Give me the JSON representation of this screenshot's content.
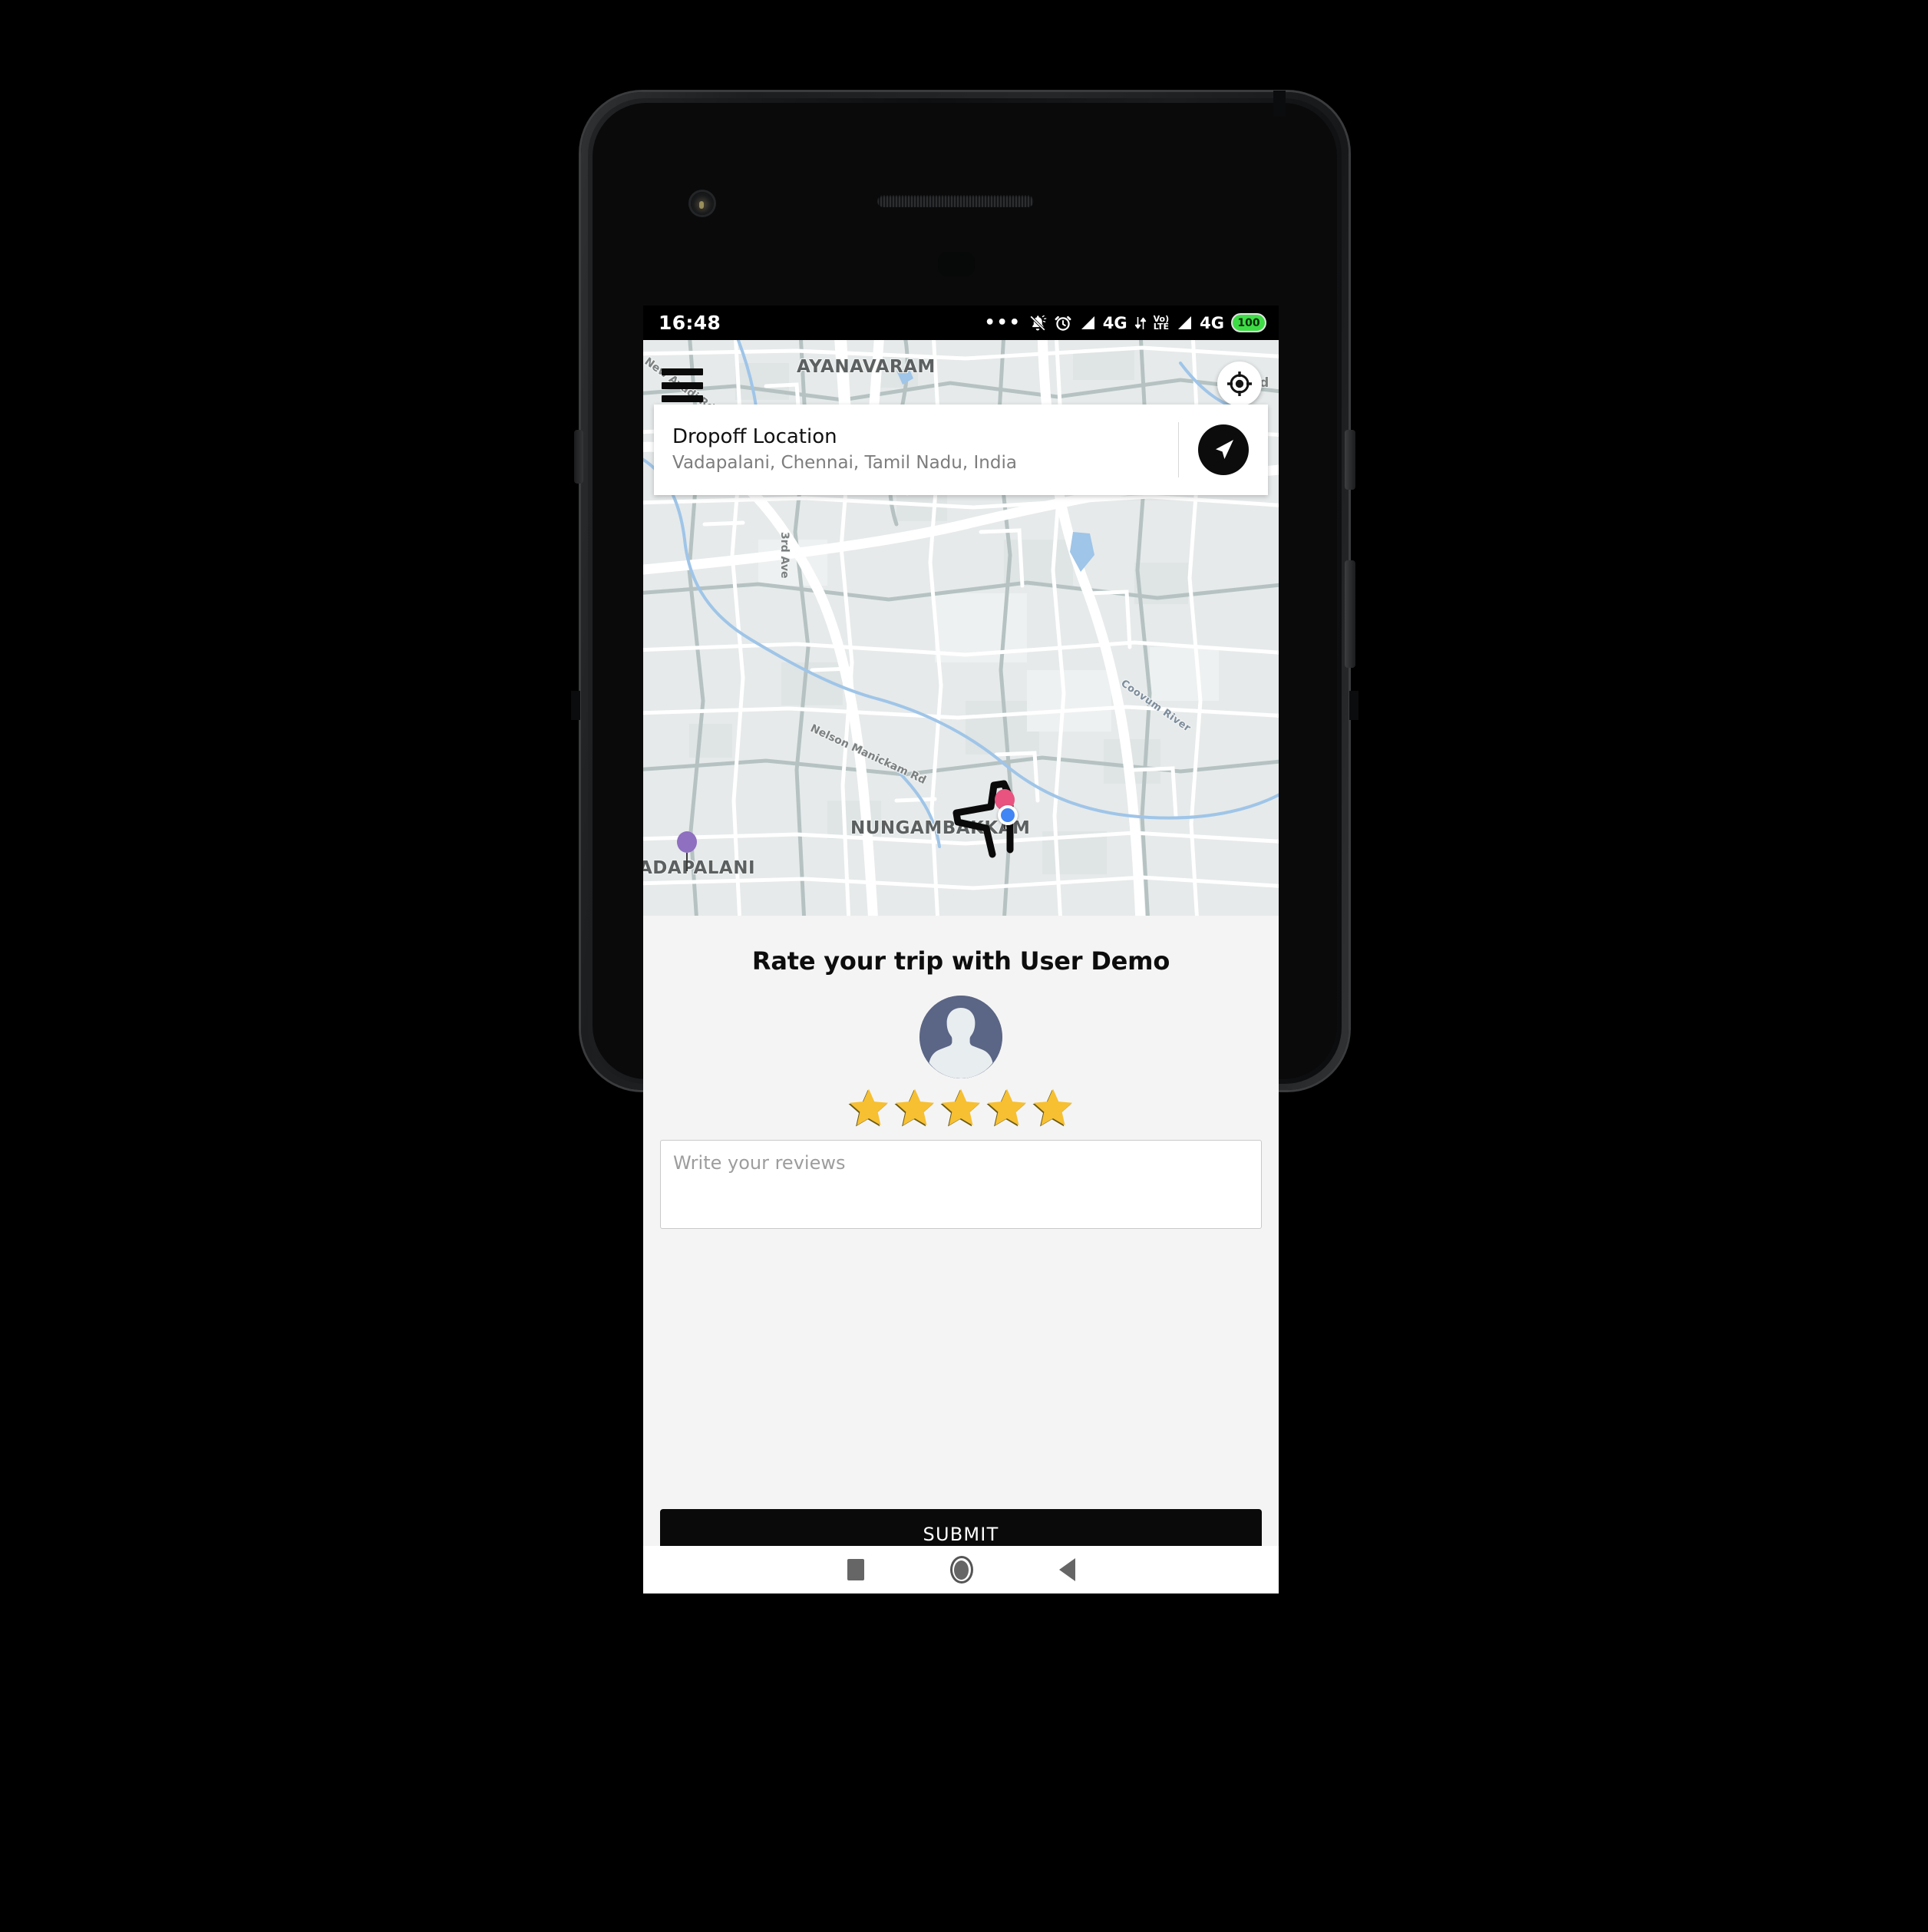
{
  "status_bar": {
    "time": "16:48",
    "icons": [
      "ellipsis-icon",
      "bell-muted-icon",
      "alarm-clock-icon",
      "signal-bars-icon",
      "data-arrows-icon",
      "signal-bars-icon"
    ],
    "network_label_1": "4G",
    "volte_top": "Vo)",
    "volte_bottom": "LTE",
    "network_label_2": "4G",
    "battery_level": "100"
  },
  "map": {
    "menu_icon": "hamburger-menu-icon",
    "locate_icon": "my-location-crosshair-icon",
    "labels": {
      "ayanavaram": "AYANAVARAM",
      "nungambakkam": "NUNGAMBAKKAM",
      "vadapalani": "ADAPALANI",
      "new_avadi_rd": "New Avadi Rd",
      "third_ave": "3rd Ave",
      "nelson_manickam_rd": "Nelson Manickam Rd",
      "coovum_river": "Coovum River",
      "rd_fragment": "Rd"
    },
    "markers": {
      "dropoff_pin_color": "#8e6fc0",
      "pickup_pin_color": "#e8547f",
      "current_location_color": "#4285f4",
      "route_color": "#0a0a0a"
    }
  },
  "dropoff_card": {
    "title": "Dropoff Location",
    "address": "Vadapalani, Chennai, Tamil Nadu, India",
    "nav_icon": "navigation-arrow-icon"
  },
  "rating": {
    "title": "Rate your trip with User Demo",
    "avatar_icon": "default-user-avatar-icon",
    "stars_total": 5,
    "stars_selected": 5,
    "star_color": "#f6c032"
  },
  "review": {
    "value": "",
    "placeholder": "Write your reviews"
  },
  "submit": {
    "label": "SUBMIT"
  },
  "navbar": {
    "recents": "recents-square-icon",
    "home": "home-circle-icon",
    "back": "back-triangle-icon"
  }
}
